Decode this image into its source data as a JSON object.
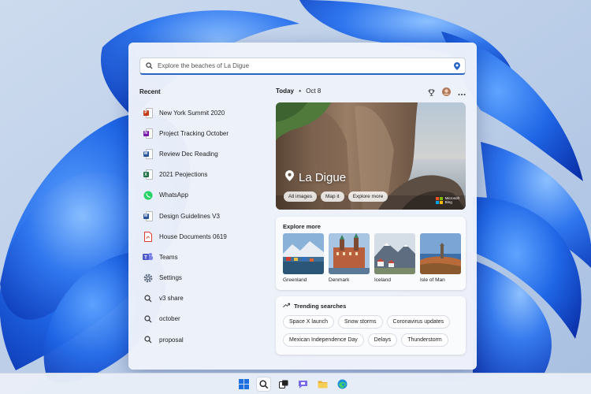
{
  "search": {
    "placeholder": "Explore the beaches of La Digue"
  },
  "recent": {
    "label": "Recent",
    "items": [
      {
        "label": "New York Summit 2020",
        "icon": "powerpoint-icon",
        "color": "#c43e1c"
      },
      {
        "label": "Project Tracking October",
        "icon": "onenote-icon",
        "color": "#7719aa"
      },
      {
        "label": "Review Dec Reading",
        "icon": "word-icon",
        "color": "#2b579a"
      },
      {
        "label": "2021 Peojections",
        "icon": "excel-icon",
        "color": "#217346"
      },
      {
        "label": "WhatsApp",
        "icon": "whatsapp-icon",
        "color": "#25d366"
      },
      {
        "label": "Design Guidelines V3",
        "icon": "word-icon",
        "color": "#2b579a"
      },
      {
        "label": "House Documents 0619",
        "icon": "pdf-icon",
        "color": "#e03c31"
      },
      {
        "label": "Teams",
        "icon": "teams-icon",
        "color": "#5059c9"
      },
      {
        "label": "Settings",
        "icon": "gear-icon",
        "color": "#5b6b80"
      },
      {
        "label": "v3 share",
        "icon": "search-icon",
        "color": "#333333"
      },
      {
        "label": "october",
        "icon": "search-icon",
        "color": "#333333"
      },
      {
        "label": "proposal",
        "icon": "search-icon",
        "color": "#333333"
      }
    ]
  },
  "today": {
    "label": "Today",
    "date": "Oct 8"
  },
  "hero": {
    "title": "La Digue",
    "chips": [
      "All images",
      "Map it",
      "Explore more"
    ],
    "badge_line1": "Microsoft",
    "badge_line2": "Bing"
  },
  "explore": {
    "title": "Explore more",
    "items": [
      "Greenland",
      "Denmark",
      "Iceland",
      "Isle of Man"
    ]
  },
  "trending": {
    "title": "Trending searches",
    "items": [
      "Space X launch",
      "Snow storms",
      "Coronavirus updates",
      "Mexican Independence Day",
      "Delays",
      "Thunderstorm"
    ]
  },
  "colors": {
    "accent": "#2a66c6",
    "wallpaper_blue": "#1d63e0"
  }
}
